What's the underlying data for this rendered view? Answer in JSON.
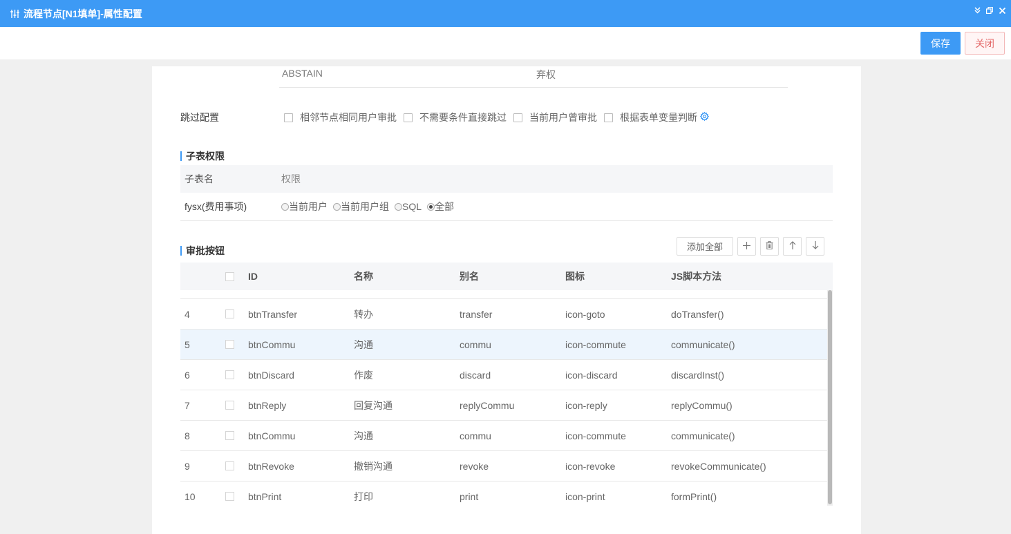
{
  "window": {
    "title": "流程节点[N1填单]-属性配置",
    "controls": [
      "collapse-icon",
      "restore-icon",
      "close-icon"
    ]
  },
  "toolbar": {
    "save_label": "保存",
    "close_label": "关闭"
  },
  "abstain_row": {
    "code": "ABSTAIN",
    "label": "弃权"
  },
  "skip_config": {
    "label": "跳过配置",
    "options": [
      {
        "label": "相邻节点相同用户审批",
        "checked": false
      },
      {
        "label": "不需要条件直接跳过",
        "checked": false
      },
      {
        "label": "当前用户曾审批",
        "checked": false
      },
      {
        "label": "根据表单变量判断",
        "checked": false
      }
    ]
  },
  "subtable_permission": {
    "title": "子表权限",
    "headers": [
      "子表名",
      "权限"
    ],
    "rows": [
      {
        "name": "fysx(费用事项)",
        "options": [
          {
            "label": "当前用户",
            "selected": false
          },
          {
            "label": "当前用户组",
            "selected": false
          },
          {
            "label": "SQL",
            "selected": false
          },
          {
            "label": "全部",
            "selected": true
          }
        ]
      }
    ]
  },
  "approval_buttons": {
    "title": "审批按钮",
    "actions": {
      "add_all_label": "添加全部",
      "add_icon": "plus-icon",
      "delete_icon": "trash-icon",
      "up_icon": "arrow-up-icon",
      "down_icon": "arrow-down-icon"
    },
    "headers": [
      "",
      "",
      "ID",
      "名称",
      "别名",
      "图标",
      "JS脚本方法"
    ],
    "rows": [
      {
        "index": "4",
        "id": "btnTransfer",
        "name": "转办",
        "alias": "transfer",
        "icon": "icon-goto",
        "script": "doTransfer()"
      },
      {
        "index": "5",
        "id": "btnCommu",
        "name": "沟通",
        "alias": "commu",
        "icon": "icon-commute",
        "script": "communicate()"
      },
      {
        "index": "6",
        "id": "btnDiscard",
        "name": "作废",
        "alias": "discard",
        "icon": "icon-discard",
        "script": "discardInst()"
      },
      {
        "index": "7",
        "id": "btnReply",
        "name": "回复沟通",
        "alias": "replyCommu",
        "icon": "icon-reply",
        "script": "replyCommu()"
      },
      {
        "index": "8",
        "id": "btnCommu",
        "name": "沟通",
        "alias": "commu",
        "icon": "icon-commute",
        "script": "communicate()"
      },
      {
        "index": "9",
        "id": "btnRevoke",
        "name": "撤销沟通",
        "alias": "revoke",
        "icon": "icon-revoke",
        "script": "revokeCommunicate()"
      },
      {
        "index": "10",
        "id": "btnPrint",
        "name": "打印",
        "alias": "print",
        "icon": "icon-print",
        "script": "formPrint()"
      }
    ],
    "highlighted_row": "5"
  },
  "colors": {
    "accent": "#3d9af5",
    "row_highlight": "#edf5fd",
    "close_text": "#e46a6a"
  }
}
